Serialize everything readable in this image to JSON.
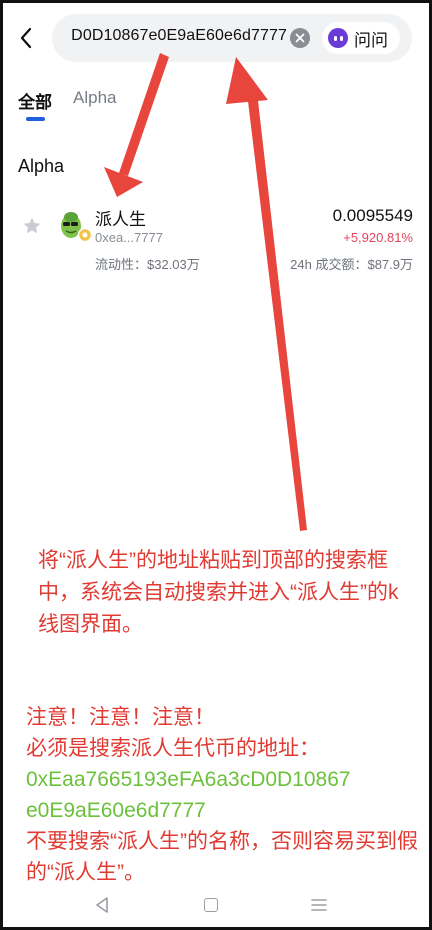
{
  "search": {
    "query": "0xEaa7665193eFA6a3cD0D10867e0E9aE60e6d7777",
    "ask_label": "问问"
  },
  "tabs": [
    {
      "label": "全部",
      "active": true
    },
    {
      "label": "Alpha",
      "active": false
    }
  ],
  "section_title": "Alpha",
  "token": {
    "name": "派人生",
    "address": "0xea...7777",
    "liquidity": "流动性：$32.03万",
    "price": "0.0095549",
    "change": "+5,920.81%",
    "volume": "24h 成交额：$87.9万"
  },
  "annotation": {
    "instruction": "将“派人生”的地址粘贴到顶部的搜索框中，系统会自动搜索并进入“派人生”的k线图界面。",
    "warning": "注意！注意！注意！",
    "must": "必须是搜索派人生代币的地址：",
    "address_line1": "0xEaa7665193eFA6a3cD0D10867",
    "address_line2": "e0E9aE60e6d7777",
    "caution": "不要搜索“派人生”的名称，否则容易买到假的“派人生”。"
  },
  "colors": {
    "accent": "#1f5fe0",
    "negative": "#e2445c",
    "annotation_red": "#e03b33",
    "annotation_green": "#6cc13c"
  },
  "icons": [
    "back-arrow-icon",
    "clear-icon",
    "ask-ai-icon",
    "star-icon",
    "token-logo",
    "nav-back-icon",
    "nav-home-icon",
    "nav-menu-icon"
  ]
}
